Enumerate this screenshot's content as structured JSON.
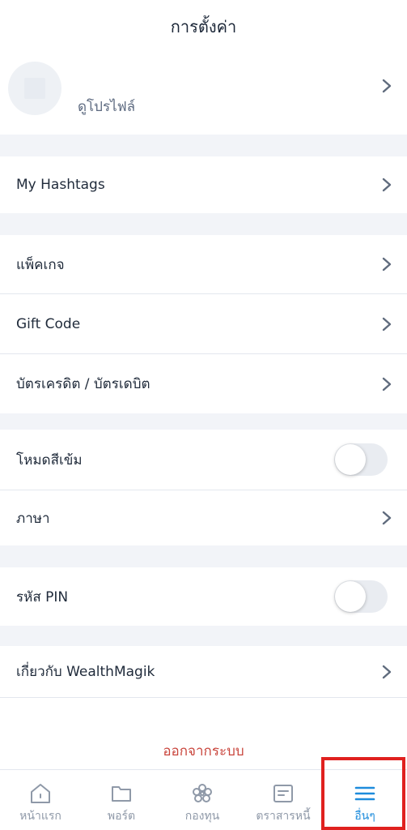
{
  "header": {
    "title": "การตั้งค่า"
  },
  "profile": {
    "label": "ดูโปรไฟล์"
  },
  "menu": {
    "hashtags": "My Hashtags",
    "package": "แพ็คเกจ",
    "gift_code": "Gift Code",
    "cards": "บัตรเครดิต / บัตรเดบิต",
    "dark_mode": "โหมดสีเข้ม",
    "language": "ภาษา",
    "pin": "รหัส PIN",
    "about": "เกี่ยวกับ WealthMagik"
  },
  "toggles": {
    "dark_mode_on": false,
    "pin_on": false
  },
  "logout": {
    "label": "ออกจากระบบ"
  },
  "tabbar": {
    "items": [
      {
        "label": "หน้าแรก",
        "icon": "home-icon"
      },
      {
        "label": "พอร์ต",
        "icon": "folder-icon"
      },
      {
        "label": "กองทุน",
        "icon": "fund-icon"
      },
      {
        "label": "ตราสารหนี้",
        "icon": "bond-icon"
      },
      {
        "label": "อื่นๆ",
        "icon": "menu-icon"
      }
    ],
    "active_index": 4
  },
  "colors": {
    "accent": "#1e8cdc",
    "logout": "#c9463d",
    "highlight": "#e0211f"
  }
}
